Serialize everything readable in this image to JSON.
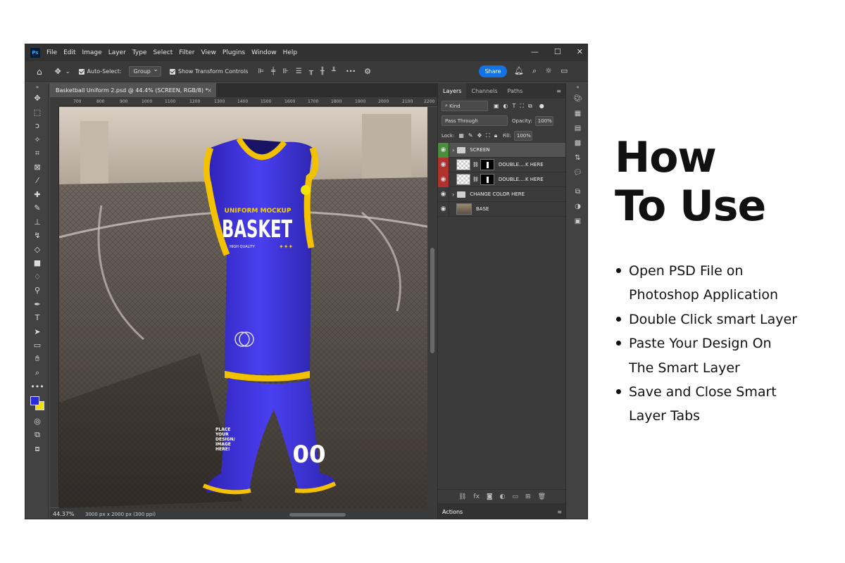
{
  "app": {
    "logo": "Ps",
    "menu": [
      "File",
      "Edit",
      "Image",
      "Layer",
      "Type",
      "Select",
      "Filter",
      "View",
      "Plugins",
      "Window",
      "Help"
    ],
    "window_controls": [
      "—",
      "☐",
      "✕"
    ]
  },
  "options_bar": {
    "auto_select_label": "Auto-Select:",
    "auto_select_value": "Group",
    "show_transform_label": "Show Transform Controls",
    "more": "•••",
    "share_label": "Share"
  },
  "document": {
    "tab_title": "Basketball Uniform 2.psd @ 44.4% (SCREEN, RGB/8) *",
    "tab_close": "×",
    "ruler_ticks": [
      "700",
      "800",
      "900",
      "1000",
      "1100",
      "1200",
      "1300",
      "1400",
      "1500",
      "1600",
      "1700",
      "1800",
      "1900",
      "2000",
      "2100",
      "2200"
    ],
    "zoom": "44.37%",
    "size_info": "3000 px x 2000 px (300 ppi)"
  },
  "mockup": {
    "jersey_top_line": "UNIFORM MOCKUP",
    "jersey_main": "BASKET",
    "jersey_sub": "HIGH QUALITY",
    "shorts_text": [
      "PLACE",
      "YOUR",
      "DESIGN/",
      "IMAGE",
      "HERE!"
    ],
    "shorts_number": "00",
    "colors": {
      "jersey": "#3a2fd6",
      "trim": "#f2c200",
      "floor": "#5a5048"
    }
  },
  "layers_panel": {
    "tabs": [
      "Layers",
      "Channels",
      "Paths"
    ],
    "kind_label": "Kind",
    "blend_mode": "Pass Through",
    "opacity_label": "Opacity:",
    "opacity_value": "100%",
    "lock_label": "Lock:",
    "fill_label": "Fill:",
    "fill_value": "100%",
    "layers": [
      {
        "name": "SCREEN",
        "type": "group",
        "eye": "green"
      },
      {
        "name": "DOUBLE....K HERE",
        "type": "smart",
        "eye": "red"
      },
      {
        "name": "DOUBLE....K HERE",
        "type": "smart",
        "eye": "red"
      },
      {
        "name": "CHANGE COLOR HERE",
        "type": "group",
        "eye": "normal"
      },
      {
        "name": "BASE",
        "type": "image",
        "eye": "normal"
      }
    ],
    "actions_label": "Actions"
  },
  "instructions": {
    "heading_line1": "How",
    "heading_line2": "To Use",
    "steps": [
      [
        "Open PSD File on",
        "Photoshop Application"
      ],
      [
        "Double Click smart Layer"
      ],
      [
        "Paste Your Design On",
        "The Smart Layer"
      ],
      [
        "Save and Close Smart",
        "Layer Tabs"
      ]
    ]
  }
}
